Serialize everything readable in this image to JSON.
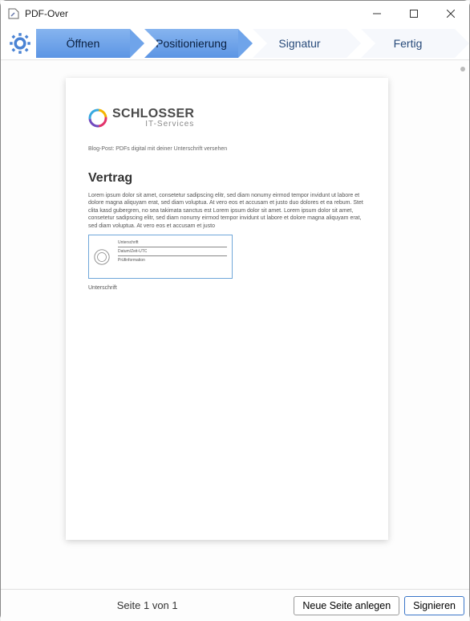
{
  "window": {
    "title": "PDF-Over"
  },
  "steps": {
    "open": "Öffnen",
    "position": "Positionierung",
    "signature": "Signatur",
    "finish": "Fertig"
  },
  "document": {
    "logo": {
      "name": "SCHLOSSER",
      "sub": "IT-Services"
    },
    "blogpost": "Blog-Post: PDFs digital mit deiner Unterschrift versehen",
    "heading": "Vertrag",
    "paragraph": "Lorem ipsum dolor sit amet, consetetur sadipscing elitr, sed diam nonumy eirmod tempor invidunt ut labore et dolore magna aliquyam erat, sed diam voluptua. At vero eos et accusam et justo duo dolores et ea rebum. Stet clita kasd gubergren, no sea takimata sanctus est Lorem ipsum dolor sit amet. Lorem ipsum dolor sit amet, consetetur sadipscing elitr, sed diam nonumy eirmod tempor invidunt ut labore et dolore magna aliquyam erat, sed diam voluptua. At vero eos et accusam et justo",
    "sigbox": {
      "line1": "Unterschrift",
      "line2": "Datum/Zeit-UTC",
      "line3": "Prüfinformation"
    },
    "sigLabel": "Unterschrift"
  },
  "footer": {
    "pageInfo": "Seite 1 von 1",
    "newPage": "Neue Seite anlegen",
    "sign": "Signieren"
  }
}
